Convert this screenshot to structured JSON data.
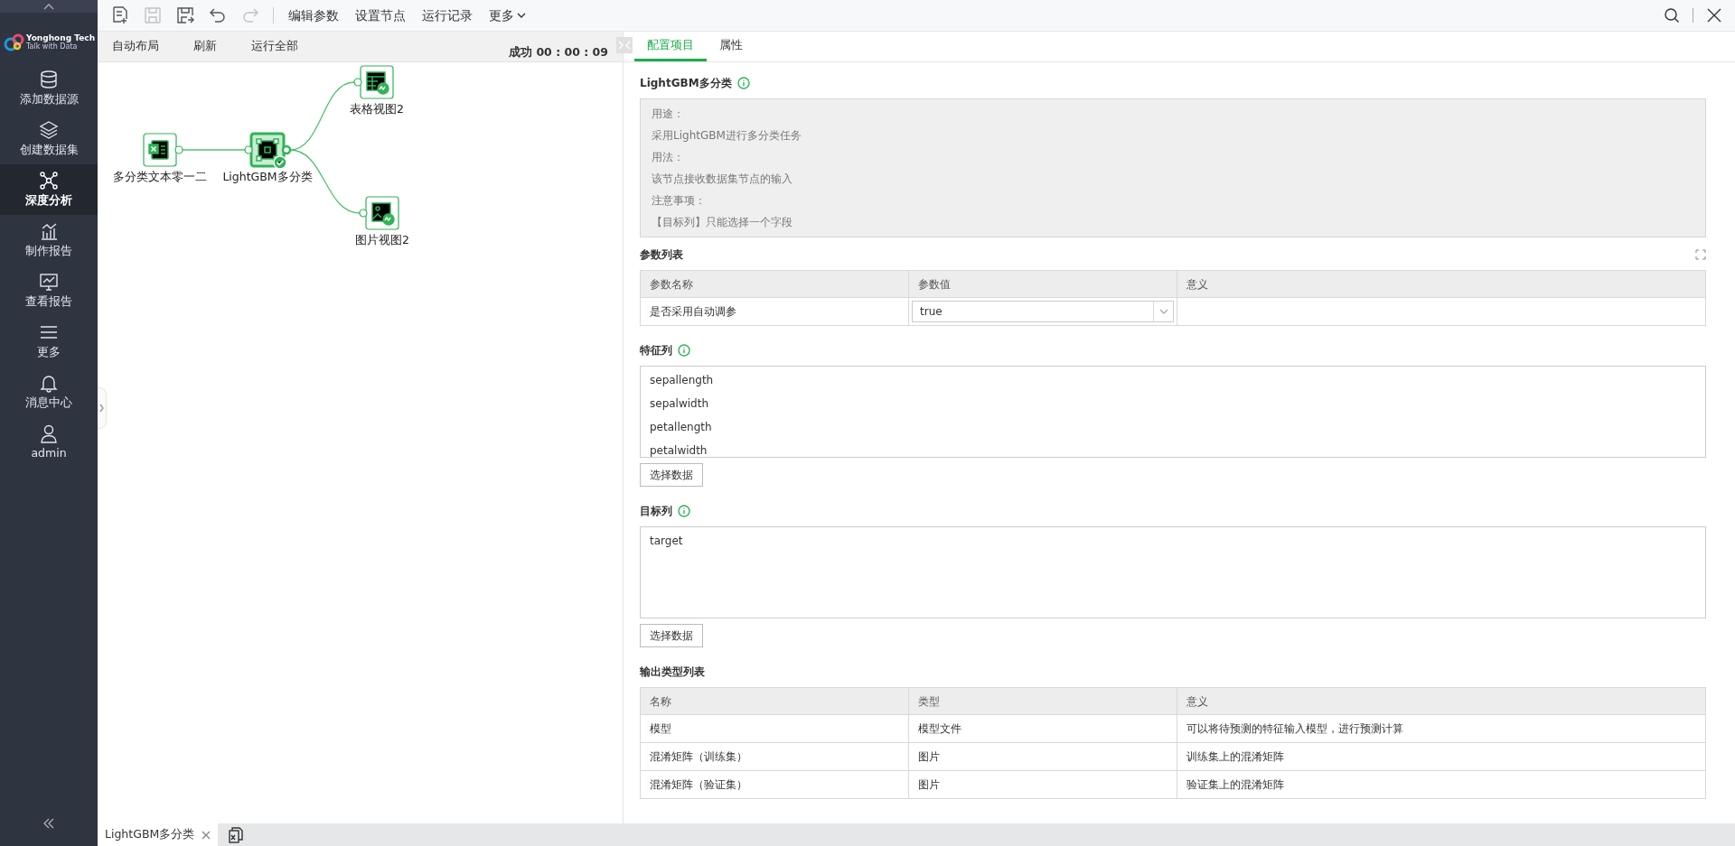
{
  "sidebar": {
    "logo": {
      "name": "Yonghong Tech",
      "tagline": "Talk with Data"
    },
    "items": [
      {
        "label": "添加数据源",
        "selected": false
      },
      {
        "label": "创建数据集",
        "selected": false
      },
      {
        "label": "深度分析",
        "selected": true
      },
      {
        "label": "制作报告",
        "selected": false
      },
      {
        "label": "查看报告",
        "selected": false
      },
      {
        "label": "更多",
        "selected": false
      },
      {
        "label": "消息中心",
        "selected": false
      },
      {
        "label": "admin",
        "selected": false
      }
    ]
  },
  "toolbar": {
    "icons": [
      {
        "kind": "new",
        "disabled": false
      },
      {
        "kind": "save",
        "disabled": true
      },
      {
        "kind": "save-as",
        "disabled": false
      },
      {
        "kind": "undo",
        "disabled": false
      },
      {
        "kind": "redo",
        "disabled": true
      }
    ],
    "menus": [
      {
        "label": "编辑参数",
        "dropdown": false
      },
      {
        "label": "设置节点",
        "dropdown": false
      },
      {
        "label": "运行记录",
        "dropdown": false
      },
      {
        "label": "更多",
        "dropdown": true
      }
    ]
  },
  "canvas_toolbar": {
    "buttons": [
      "自动布局",
      "刷新",
      "运行全部"
    ],
    "status": "成功",
    "elapsed": "00 : 00 : 09"
  },
  "canvas": {
    "nodes": [
      {
        "label": "多分类文本零一二",
        "kind": "excel",
        "selected": false,
        "succeeded": false
      },
      {
        "label": "LightGBM多分类",
        "kind": "model",
        "selected": true,
        "succeeded": true
      },
      {
        "label": "表格视图2",
        "kind": "table",
        "selected": false,
        "succeeded": false
      },
      {
        "label": "图片视图2",
        "kind": "image",
        "selected": false,
        "succeeded": false
      }
    ]
  },
  "panel": {
    "tabs": [
      {
        "label": "配置项目",
        "selected": true
      },
      {
        "label": "属性",
        "selected": false
      }
    ],
    "node_title": "LightGBM多分类",
    "description": [
      "用途：",
      "采用LightGBM进行多分类任务",
      "用法：",
      "该节点接收数据集节点的输入",
      "注意事项：",
      "【目标列】只能选择一个字段"
    ],
    "params": {
      "title": "参数列表",
      "columns": [
        "参数名称",
        "参数值",
        "意义"
      ],
      "rows": [
        {
          "name": "是否采用自动调参",
          "value": "true"
        }
      ]
    },
    "features": {
      "title": "特征列",
      "items": [
        "sepallength",
        "sepalwidth",
        "petallength",
        "petalwidth"
      ],
      "button": "选择数据"
    },
    "target": {
      "title": "目标列",
      "items": [
        "target"
      ],
      "button": "选择数据"
    },
    "outputs": {
      "title": "输出类型列表",
      "columns": [
        "名称",
        "类型",
        "意义"
      ],
      "rows": [
        [
          "模型",
          "模型文件",
          "可以将待预测的特征输入模型，进行预测计算"
        ],
        [
          "混淆矩阵（训练集）",
          "图片",
          "训练集上的混淆矩阵"
        ],
        [
          "混淆矩阵（验证集）",
          "图片",
          "验证集上的混淆矩阵"
        ]
      ]
    }
  },
  "bottom_tabs": [
    {
      "label": "LightGBM多分类",
      "selected": true
    }
  ]
}
